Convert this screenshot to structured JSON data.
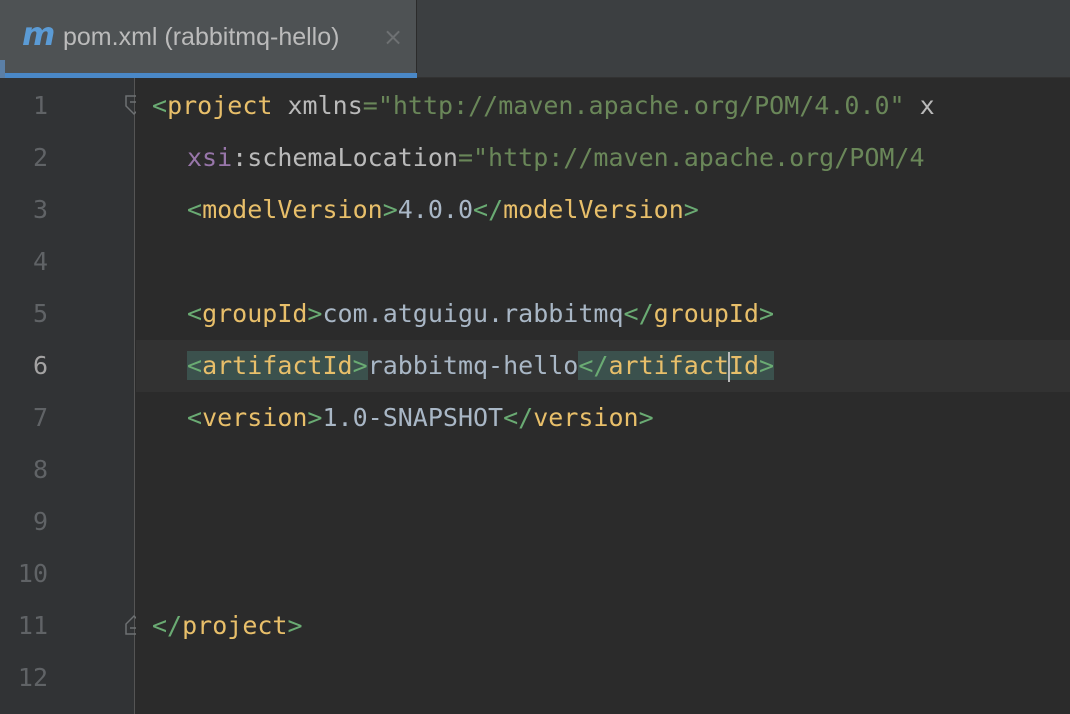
{
  "tab": {
    "icon": "m",
    "title": "pom.xml (rabbitmq-hello)",
    "close": "×"
  },
  "line_numbers": [
    "1",
    "2",
    "3",
    "4",
    "5",
    "6",
    "7",
    "8",
    "9",
    "10",
    "11",
    "12"
  ],
  "current_line": 6,
  "code": {
    "l1": {
      "open": "<",
      "tag": "project",
      "attr": "xmlns",
      "eq": "=",
      "value": "\"http://maven.apache.org/POM/4.0.0\"",
      "tail": " x"
    },
    "l2": {
      "ns": "xsi",
      "colon": ":",
      "attr": "schemaLocation",
      "eq": "=",
      "value": "\"http://maven.apache.org/POM/4"
    },
    "l3": {
      "open_lt": "<",
      "open_tag": "modelVersion",
      "open_gt": ">",
      "text": "4.0.0",
      "close_lt": "</",
      "close_tag": "modelVersion",
      "close_gt": ">"
    },
    "l5": {
      "open_lt": "<",
      "open_tag": "groupId",
      "open_gt": ">",
      "text": "com.atguigu.rabbitmq",
      "close_lt": "</",
      "close_tag": "groupId",
      "close_gt": ">"
    },
    "l6": {
      "open_lt": "<",
      "open_tag": "artifactId",
      "open_gt": ">",
      "text": "rabbitmq-hello",
      "close_lt": "</",
      "close_tag_a": "artifact",
      "close_tag_b": "Id",
      "close_gt": ">"
    },
    "l7": {
      "open_lt": "<",
      "open_tag": "version",
      "open_gt": ">",
      "text": "1.0-SNAPSHOT",
      "close_lt": "</",
      "close_tag": "version",
      "close_gt": ">"
    },
    "l11": {
      "close_lt": "</",
      "close_tag": "project",
      "close_gt": ">"
    }
  },
  "colors": {
    "background": "#2b2b2b",
    "gutter": "#313335",
    "tag": "#e8bf6a",
    "bracket": "#6aab73",
    "string": "#6a8759",
    "namespace": "#9876aa",
    "tab_underline": "#4a88c7",
    "brace_match_highlight": "#3b514d"
  },
  "icons": {
    "tab_file_icon": "maven-m-icon",
    "fold_open": "fold-open-icon",
    "fold_close": "fold-close-icon"
  }
}
